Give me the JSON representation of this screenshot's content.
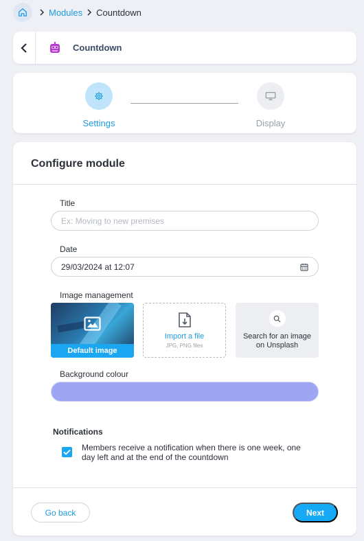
{
  "breadcrumb": {
    "home_icon": "home-icon",
    "items": [
      "Modules",
      "Countdown"
    ]
  },
  "header": {
    "back_icon": "chevron-left-icon",
    "module_icon": "countdown-robot-icon",
    "title": "Countdown"
  },
  "steps": [
    {
      "label": "Settings",
      "icon": "gear-icon",
      "active": true
    },
    {
      "label": "Display",
      "icon": "monitor-icon",
      "active": false
    }
  ],
  "form": {
    "heading": "Configure module",
    "title_label": "Title",
    "title_value": "",
    "title_placeholder": "Ex: Moving to new premises",
    "date_label": "Date",
    "date_value": "29/03/2024 at 12:07",
    "image_label": "Image management",
    "image_options": {
      "default_label": "Default image",
      "import_label": "Import a file",
      "import_sub": "JPG, PNG files",
      "search_label": "Search for an image on Unsplash"
    },
    "bg_label": "Background colour",
    "bg_color": "#9ea6f3",
    "notifications_title": "Notifications",
    "notifications_checked": true,
    "notifications_text": "Members receive a notification when there is one week, one day left and at the end of the countdown"
  },
  "actions": {
    "back_label": "Go back",
    "next_label": "Next"
  },
  "colors": {
    "accent": "#1aa6f0",
    "background": "#eef0f5"
  }
}
